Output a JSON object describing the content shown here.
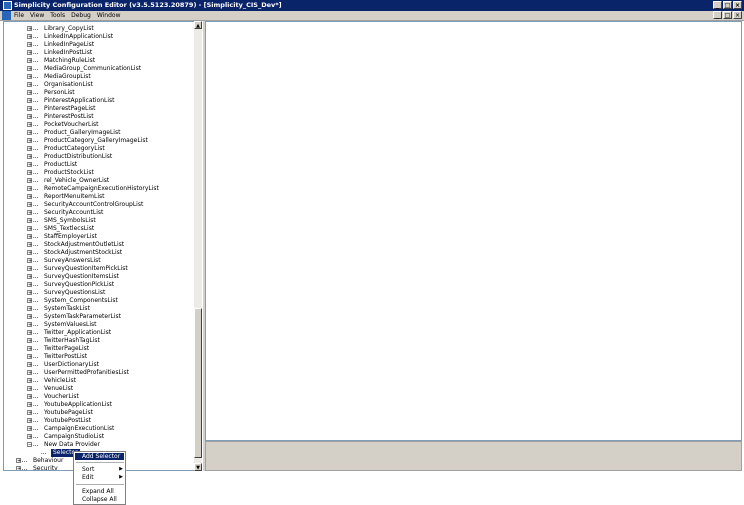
{
  "window": {
    "title": "Simplicity Configuration Editor (v3.5.5123.20879) - [Simplicity_CIS_Dev*]"
  },
  "menubar": {
    "items": [
      "File",
      "View",
      "Tools",
      "Debug",
      "Window"
    ]
  },
  "tree": {
    "items": [
      "Library_CopyList",
      "LinkedInApplicationList",
      "LinkedInPageList",
      "LinkedInPostList",
      "MatchingRuleList",
      "MediaGroup_CommunicationList",
      "MediaGroupList",
      "OrganisationList",
      "PersonList",
      "PinterestApplicationList",
      "PinterestPageList",
      "PinterestPostList",
      "PocketVoucherList",
      "Product_GalleryImageList",
      "ProductCategory_GalleryImageList",
      "ProductCategoryList",
      "ProductDistributionList",
      "ProductList",
      "ProductStockList",
      "rel_Vehicle_OwnerList",
      "RemoteCampaignExecutionHistoryList",
      "ReportMenuItemList",
      "SecurityAccountControlGroupList",
      "SecurityAccountList",
      "SMS_SymbolsList",
      "SMS_TextlecsList",
      "StaffEmployerList",
      "StockAdjustmentOutletList",
      "StockAdjustmentStockList",
      "SurveyAnswersList",
      "SurveyQuestionItemPickList",
      "SurveyQuestionItemsList",
      "SurveyQuestionPickList",
      "SurveyQuestionsList",
      "System_ComponentsList",
      "SystemTaskList",
      "SystemTaskParameterList",
      "SystemValuesList",
      "Twitter_ApplicationList",
      "TwitterHashTagList",
      "TwitterPageList",
      "TwitterPostList",
      "UserDictionaryList",
      "UserPermittedProfanitiesList",
      "VehicleList",
      "VenueList",
      "VoucherList",
      "YoutubeApplicationList",
      "YoutubePageList",
      "YoutubePostList",
      "CampaignExecutionList",
      "CampaignStudioList"
    ],
    "new_data_provider": "New Data Provider",
    "selector": "Selector",
    "behaviour": "Behaviour",
    "security": "Security",
    "expand_glyph": "+",
    "collapse_glyph": "−"
  },
  "context_menu": {
    "add_selector": "Add Selector",
    "sort": "Sort",
    "edit": "Edit",
    "expand_all": "Expand All",
    "collapse_all": "Collapse All",
    "submenu_arrow": "▶"
  },
  "window_buttons": {
    "minimize": "_",
    "maximize": "□",
    "close": "×"
  },
  "colors": {
    "titlebar": "#0a246a",
    "selection": "#0a246a",
    "chrome": "#d4d0c8"
  }
}
